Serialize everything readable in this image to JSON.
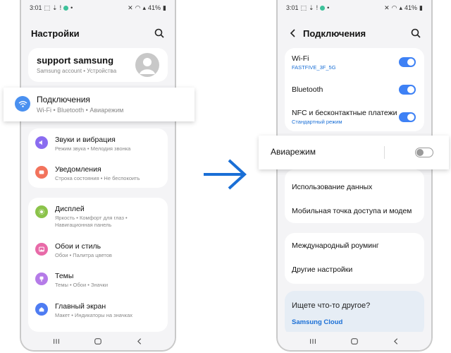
{
  "status_left": {
    "time": "3:01",
    "battery": "41%"
  },
  "status_right": {
    "time": "3:01",
    "battery": "41%"
  },
  "settings": {
    "title": "Настройки",
    "profile": {
      "name": "support samsung",
      "sub": "Samsung account  •  Устройства"
    },
    "connections": {
      "title": "Подключения",
      "sub": "Wi-Fi  •  Bluetooth  •  Авиарежим"
    },
    "items": [
      {
        "title": "Звуки и вибрация",
        "sub": "Режим звука  •  Мелодия звонка"
      },
      {
        "title": "Уведомления",
        "sub": "Строка состояния  •  Не беспокоить"
      },
      {
        "title": "Дисплей",
        "sub": "Яркость  •  Комфорт для глаз  •  Навигационная панель"
      },
      {
        "title": "Обои и стиль",
        "sub": "Обои  •  Палитра цветов"
      },
      {
        "title": "Темы",
        "sub": "Темы  •  Обои  •  Значки"
      },
      {
        "title": "Главный экран",
        "sub": "Макет  •  Индикаторы на значках"
      }
    ]
  },
  "connections_page": {
    "title": "Подключения",
    "wifi": {
      "title": "Wi-Fi",
      "network": "FASTFIVE_3F_5G",
      "on": true
    },
    "bluetooth": {
      "title": "Bluetooth",
      "on": true
    },
    "nfc": {
      "title": "NFC и бесконтактные платежи",
      "sub": "Стандартный режим",
      "on": true
    },
    "airplane": {
      "title": "Авиарежим",
      "on": false
    },
    "data_usage": "Использование данных",
    "hotspot": "Мобильная точка доступа и модем",
    "roaming": "Международный роуминг",
    "other": "Другие настройки",
    "looking": "Ищете что-то другое?",
    "samsung_cloud": "Samsung Cloud"
  },
  "colors": {
    "accent": "#3e81f5",
    "link": "#1a6fd6",
    "sound": "#8a6cf0",
    "notify": "#f2735c",
    "display": "#8bc34a",
    "wallpaper": "#e86aa8",
    "themes": "#b57be8",
    "home": "#4e7cf2"
  }
}
